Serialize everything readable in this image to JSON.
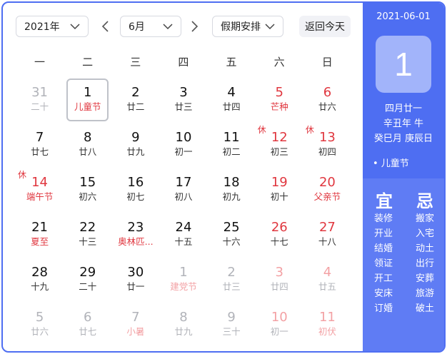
{
  "toolbar": {
    "year": "2021年",
    "month": "6月",
    "holiday": "假期安排",
    "today": "返回今天"
  },
  "weekdays": [
    "一",
    "二",
    "三",
    "四",
    "五",
    "六",
    "日"
  ],
  "days": [
    {
      "num": "31",
      "sub": "二十",
      "other": true,
      "weekend": false,
      "festival": false,
      "rest": ""
    },
    {
      "num": "1",
      "sub": "儿童节",
      "other": false,
      "weekend": false,
      "festival": true,
      "rest": "",
      "selected": true
    },
    {
      "num": "2",
      "sub": "廿二",
      "other": false,
      "weekend": false,
      "festival": false,
      "rest": ""
    },
    {
      "num": "3",
      "sub": "廿三",
      "other": false,
      "weekend": false,
      "festival": false,
      "rest": ""
    },
    {
      "num": "4",
      "sub": "廿四",
      "other": false,
      "weekend": false,
      "festival": false,
      "rest": ""
    },
    {
      "num": "5",
      "sub": "芒种",
      "other": false,
      "weekend": true,
      "festival": true,
      "rest": ""
    },
    {
      "num": "6",
      "sub": "廿六",
      "other": false,
      "weekend": true,
      "festival": false,
      "rest": ""
    },
    {
      "num": "7",
      "sub": "廿七",
      "other": false,
      "weekend": false,
      "festival": false,
      "rest": ""
    },
    {
      "num": "8",
      "sub": "廿八",
      "other": false,
      "weekend": false,
      "festival": false,
      "rest": ""
    },
    {
      "num": "9",
      "sub": "廿九",
      "other": false,
      "weekend": false,
      "festival": false,
      "rest": ""
    },
    {
      "num": "10",
      "sub": "初一",
      "other": false,
      "weekend": false,
      "festival": false,
      "rest": ""
    },
    {
      "num": "11",
      "sub": "初二",
      "other": false,
      "weekend": false,
      "festival": false,
      "rest": ""
    },
    {
      "num": "12",
      "sub": "初三",
      "other": false,
      "weekend": true,
      "festival": false,
      "rest": "休"
    },
    {
      "num": "13",
      "sub": "初四",
      "other": false,
      "weekend": true,
      "festival": false,
      "rest": "休"
    },
    {
      "num": "14",
      "sub": "端午节",
      "other": false,
      "weekend": true,
      "festival": true,
      "rest": "休"
    },
    {
      "num": "15",
      "sub": "初六",
      "other": false,
      "weekend": false,
      "festival": false,
      "rest": ""
    },
    {
      "num": "16",
      "sub": "初七",
      "other": false,
      "weekend": false,
      "festival": false,
      "rest": ""
    },
    {
      "num": "17",
      "sub": "初八",
      "other": false,
      "weekend": false,
      "festival": false,
      "rest": ""
    },
    {
      "num": "18",
      "sub": "初九",
      "other": false,
      "weekend": false,
      "festival": false,
      "rest": ""
    },
    {
      "num": "19",
      "sub": "初十",
      "other": false,
      "weekend": true,
      "festival": false,
      "rest": ""
    },
    {
      "num": "20",
      "sub": "父亲节",
      "other": false,
      "weekend": true,
      "festival": true,
      "rest": ""
    },
    {
      "num": "21",
      "sub": "夏至",
      "other": false,
      "weekend": false,
      "festival": true,
      "rest": ""
    },
    {
      "num": "22",
      "sub": "十三",
      "other": false,
      "weekend": false,
      "festival": false,
      "rest": ""
    },
    {
      "num": "23",
      "sub": "奥林匹...",
      "other": false,
      "weekend": false,
      "festival": true,
      "rest": ""
    },
    {
      "num": "24",
      "sub": "十五",
      "other": false,
      "weekend": false,
      "festival": false,
      "rest": ""
    },
    {
      "num": "25",
      "sub": "十六",
      "other": false,
      "weekend": false,
      "festival": false,
      "rest": ""
    },
    {
      "num": "26",
      "sub": "十七",
      "other": false,
      "weekend": true,
      "festival": false,
      "rest": ""
    },
    {
      "num": "27",
      "sub": "十八",
      "other": false,
      "weekend": true,
      "festival": false,
      "rest": ""
    },
    {
      "num": "28",
      "sub": "十九",
      "other": false,
      "weekend": false,
      "festival": false,
      "rest": ""
    },
    {
      "num": "29",
      "sub": "二十",
      "other": false,
      "weekend": false,
      "festival": false,
      "rest": ""
    },
    {
      "num": "30",
      "sub": "廿一",
      "other": false,
      "weekend": false,
      "festival": false,
      "rest": ""
    },
    {
      "num": "1",
      "sub": "建党节",
      "other": true,
      "weekend": false,
      "festival": true,
      "rest": ""
    },
    {
      "num": "2",
      "sub": "廿三",
      "other": true,
      "weekend": false,
      "festival": false,
      "rest": ""
    },
    {
      "num": "3",
      "sub": "廿四",
      "other": true,
      "weekend": true,
      "festival": false,
      "rest": ""
    },
    {
      "num": "4",
      "sub": "廿五",
      "other": true,
      "weekend": true,
      "festival": false,
      "rest": ""
    },
    {
      "num": "5",
      "sub": "廿六",
      "other": true,
      "weekend": false,
      "festival": false,
      "rest": ""
    },
    {
      "num": "6",
      "sub": "廿七",
      "other": true,
      "weekend": false,
      "festival": false,
      "rest": ""
    },
    {
      "num": "7",
      "sub": "小暑",
      "other": true,
      "weekend": false,
      "festival": true,
      "rest": ""
    },
    {
      "num": "8",
      "sub": "廿九",
      "other": true,
      "weekend": false,
      "festival": false,
      "rest": ""
    },
    {
      "num": "9",
      "sub": "三十",
      "other": true,
      "weekend": false,
      "festival": false,
      "rest": ""
    },
    {
      "num": "10",
      "sub": "初一",
      "other": true,
      "weekend": true,
      "festival": false,
      "rest": ""
    },
    {
      "num": "11",
      "sub": "初伏",
      "other": true,
      "weekend": true,
      "festival": true,
      "rest": ""
    }
  ],
  "panel": {
    "date": "2021-06-01",
    "day": "1",
    "lunar": "四月廿一",
    "ganzhi_year": "辛丑年 牛",
    "ganzhi_month_day": "癸巳月 庚辰日",
    "festival": "• 儿童节",
    "yi_title": "宜",
    "ji_title": "忌",
    "yi": [
      "装修",
      "开业",
      "结婚",
      "领证",
      "开工",
      "安床",
      "订婚"
    ],
    "ji": [
      "搬家",
      "入宅",
      "动土",
      "出行",
      "安葬",
      "旅游",
      "破土"
    ]
  },
  "colors": {
    "accent": "#4E6EF2",
    "panel_bottom": "#5F7CF4",
    "holiday_red": "#e0373f"
  }
}
